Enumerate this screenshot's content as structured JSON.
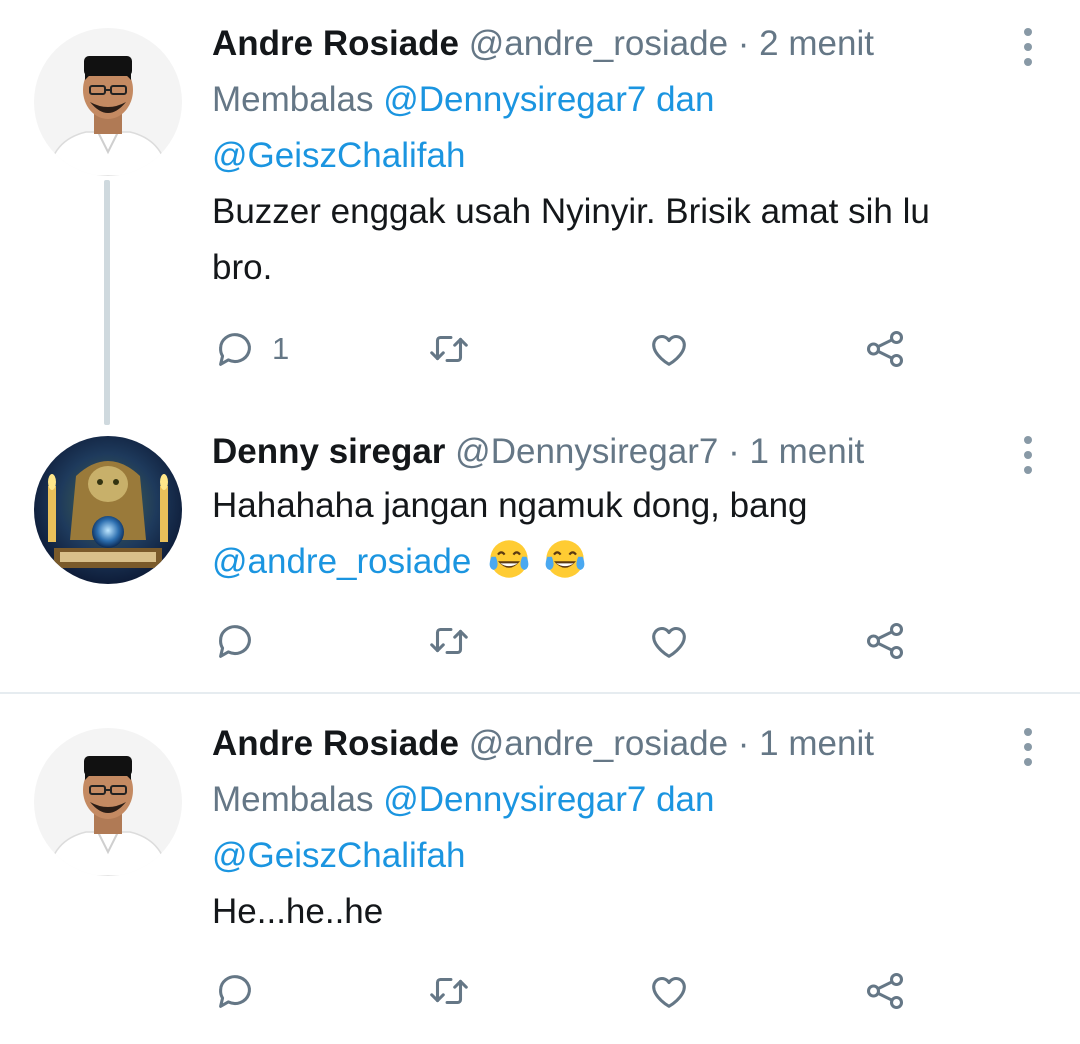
{
  "tweets": [
    {
      "name": "Andre Rosiade",
      "handle": "@andre_rosiade",
      "sep": "·",
      "time": "2 menit",
      "replying_prefix": "Membalas",
      "replying_m1": "@Dennysiregar7",
      "replying_and": "dan",
      "replying_m2": "@GeiszChalifah",
      "body_line1": "Buzzer enggak usah Nyinyir. Brisik amat sih lu",
      "body_line2": "bro.",
      "reply_count": "1"
    },
    {
      "name": "Denny siregar",
      "handle": "@Dennysiregar7",
      "sep": "·",
      "time": "1 menit",
      "body_line1": "Hahahaha jangan ngamuk dong, bang",
      "body_mention": "@andre_rosiade",
      "emojis": [
        "face-with-tears-of-joy",
        "face-with-tears-of-joy"
      ]
    },
    {
      "name": "Andre Rosiade",
      "handle": "@andre_rosiade",
      "sep": "·",
      "time": "1 menit",
      "replying_prefix": "Membalas",
      "replying_m1": "@Dennysiregar7",
      "replying_and": "dan",
      "replying_m2": "@GeiszChalifah",
      "body_line1": "He...he..he"
    }
  ],
  "icons": [
    "reply-icon",
    "retweet-icon",
    "like-icon",
    "share-icon",
    "more-icon"
  ],
  "colors": {
    "text": "#14171a",
    "muted": "#657786",
    "link": "#1b95e0",
    "divider": "#e6ecf0"
  }
}
